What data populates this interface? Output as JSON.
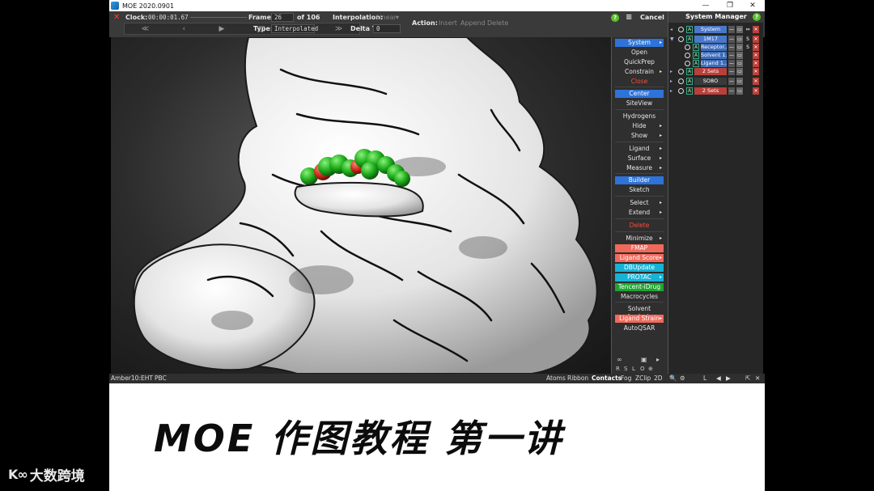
{
  "window": {
    "title": "MOE 2020.0901",
    "controls": [
      "—",
      "❐",
      "✕"
    ]
  },
  "topbar": {
    "clock_label": "Clock:",
    "clock_value": "00:00:01.67",
    "frame_label": "Frame:",
    "frame_value": "26",
    "frame_of": "of 106",
    "interp_label": "Interpolation:",
    "interp_value": "Linear",
    "type_label": "Type:",
    "type_value": "Interpolated",
    "deltat_label": "Delta T:",
    "deltat_value": "0",
    "action_label": "Action:",
    "action_insert": "Insert",
    "action_append": "Append",
    "action_delete": "Delete",
    "nav": [
      "≪",
      "‹",
      "▶",
      "□",
      "›",
      "≫"
    ],
    "help": "?",
    "menu": "≡",
    "cancel": "Cancel"
  },
  "right_panel": {
    "buttons": [
      {
        "label": "System",
        "style": "blue",
        "arrow": "▸"
      },
      {
        "label": "Open",
        "style": "plain"
      },
      {
        "label": "QuickPrep",
        "style": "plain"
      },
      {
        "label": "Constrain",
        "style": "plain",
        "arrow": "▸"
      },
      {
        "label": "Close",
        "style": "red"
      },
      {
        "label": "Center",
        "style": "blue"
      },
      {
        "label": "SiteView",
        "style": "plain"
      },
      {
        "label": "Hydrogens",
        "style": "plain"
      },
      {
        "label": "Hide",
        "style": "plain",
        "arrow": "▸"
      },
      {
        "label": "Show",
        "style": "plain",
        "arrow": "▸"
      },
      {
        "label": "Ligand",
        "style": "plain",
        "arrow": "▸"
      },
      {
        "label": "Surface",
        "style": "plain",
        "arrow": "▸"
      },
      {
        "label": "Measure",
        "style": "plain",
        "arrow": "▸"
      },
      {
        "label": "Builder",
        "style": "blue"
      },
      {
        "label": "Sketch",
        "style": "plain"
      },
      {
        "label": "Select",
        "style": "plain",
        "arrow": "▸"
      },
      {
        "label": "Extend",
        "style": "plain",
        "arrow": "▸"
      },
      {
        "label": "Delete",
        "style": "red"
      },
      {
        "label": "Minimize",
        "style": "plain",
        "arrow": "▸"
      },
      {
        "label": "FMAP",
        "style": "salmon"
      },
      {
        "label": "Ligand Score",
        "style": "salmon",
        "arrow": "▸"
      },
      {
        "label": "DBUpdate",
        "style": "cyan"
      },
      {
        "label": "PROTAC",
        "style": "cyan",
        "arrow": "▸"
      },
      {
        "label": "Tencent-iDrug",
        "style": "green"
      },
      {
        "label": "Macrocycles",
        "style": "plain"
      },
      {
        "label": "Solvent Analysis",
        "style": "plain"
      },
      {
        "label": "Ligand Strain",
        "style": "salmon",
        "arrow": "▸"
      },
      {
        "label": "AutoQSAR",
        "style": "plain"
      }
    ],
    "footer_icons": [
      "∞",
      "▣",
      "▸"
    ],
    "footer_keys": [
      "R",
      "S",
      "L",
      "O",
      "⊕"
    ]
  },
  "system_manager": {
    "title": "System Manager",
    "help": "?",
    "rows": [
      {
        "tri": "◂",
        "name": "System",
        "fill": "#4a78c8",
        "extra": "⇔"
      },
      {
        "tri": "▼",
        "name": "1M17",
        "fill": "#4a78c8",
        "extra": "S"
      },
      {
        "tri": "",
        "name": "Receptor...",
        "fill": "#3f6db8",
        "extra": "S"
      },
      {
        "tri": "",
        "name": "Solvent 1...",
        "fill": "#3f6db8",
        "extra": ""
      },
      {
        "tri": "",
        "name": "Ligand 1...",
        "fill": "#3f6db8",
        "extra": ""
      },
      {
        "tri": "▸",
        "name": "2 Sets",
        "fill": "#b9403a",
        "extra": ""
      },
      {
        "tri": "▸",
        "name": "SO8O",
        "fill": "#3a3a3a",
        "extra": ""
      },
      {
        "tri": "▸",
        "name": "2 Sets",
        "fill": "#b9403a",
        "extra": ""
      }
    ]
  },
  "status_bar": {
    "left1": "Amber10:EHT",
    "left2": "PBC",
    "right": [
      "Atoms",
      "Ribbon",
      "Contacts",
      "Fog",
      "ZClip",
      "2D"
    ],
    "icons": [
      "🔍",
      "⚙",
      "L",
      "◀",
      "▶",
      "⇱",
      "✕"
    ]
  },
  "caption": {
    "text": "MOE 作图教程 第一讲"
  },
  "watermark": {
    "mark": "K∞",
    "text": "大数跨境"
  },
  "colors": {
    "ligand_green": "#2bc02b",
    "oxygen_red": "#d32a1e",
    "surface": "#efefef"
  }
}
